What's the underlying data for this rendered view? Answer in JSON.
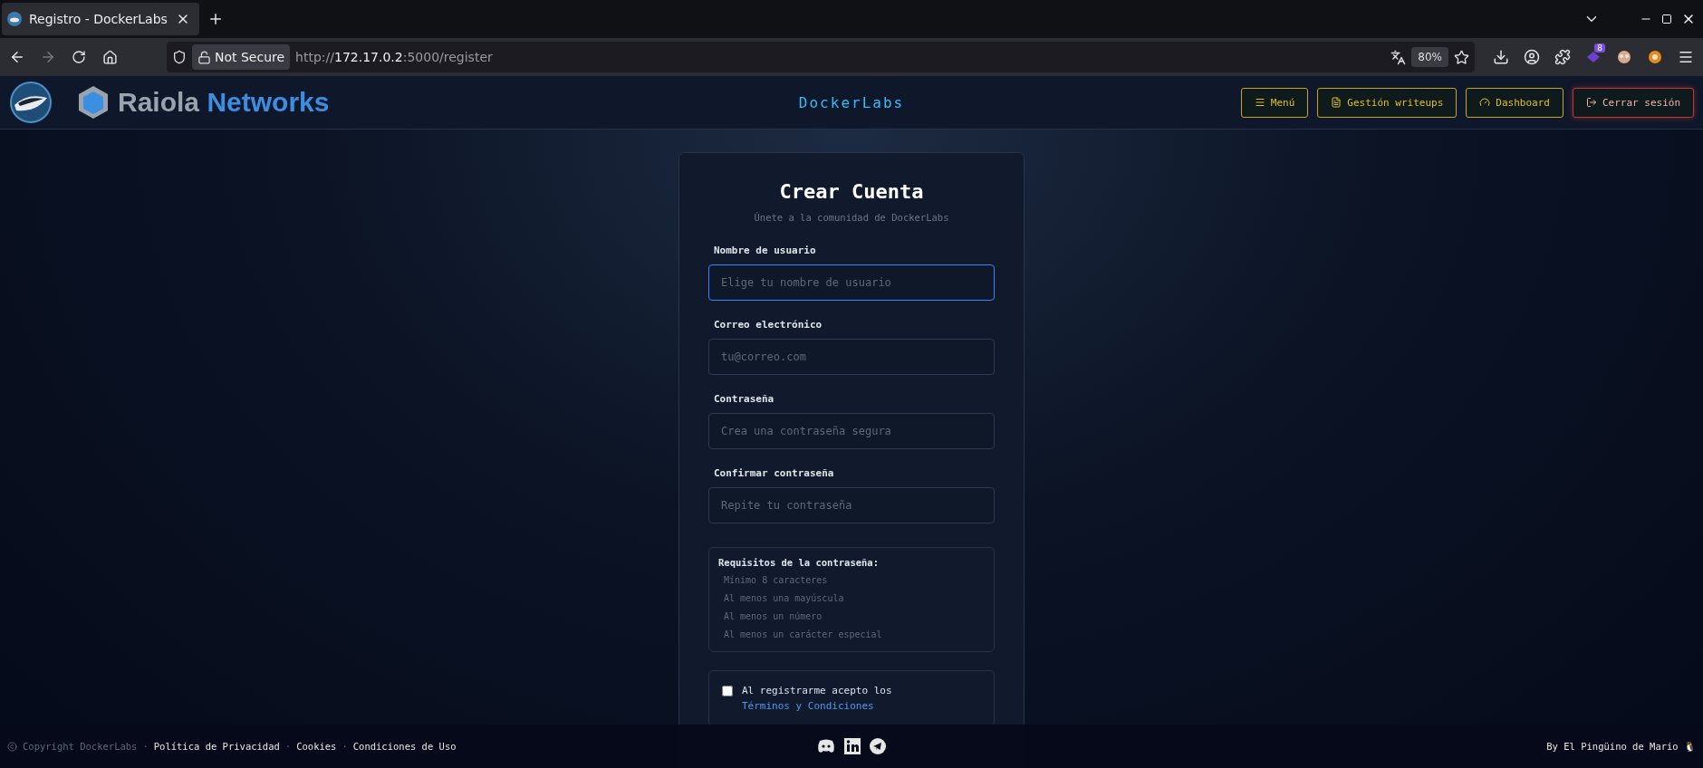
{
  "browser": {
    "tab_title": "Registro - DockerLabs",
    "url_host": "http://",
    "url_ip": "172.17.0.2",
    "url_path": ":5000/register",
    "security": "Not Secure",
    "zoom": "80%",
    "extension_badge": "8"
  },
  "header": {
    "brand": "Raiola",
    "brand_accent": "Networks",
    "site": "DockerLabs",
    "nav": [
      {
        "label": "Menú",
        "kind": "menu"
      },
      {
        "label": "Gestión writeups",
        "kind": "doc"
      },
      {
        "label": "Dashboard",
        "kind": "gauge"
      },
      {
        "label": "Cerrar sesión",
        "kind": "logout"
      }
    ]
  },
  "form": {
    "title": "Crear Cuenta",
    "subtitle": "Únete a la comunidad de DockerLabs",
    "fields": [
      {
        "label": "Nombre de usuario",
        "placeholder": "Elige tu nombre de usuario",
        "focused": true
      },
      {
        "label": "Correo electrónico",
        "placeholder": "tu@correo.com",
        "focused": false
      },
      {
        "label": "Contraseña",
        "placeholder": "Crea una contraseña segura",
        "focused": false
      },
      {
        "label": "Confirmar contraseña",
        "placeholder": "Repite tu contraseña",
        "focused": false
      }
    ],
    "requirements": {
      "title": "Requisitos de la contraseña:",
      "items": [
        "Mínimo 8 caracteres",
        "Al menos una mayúscula",
        "Al menos un número",
        "Al menos un carácter especial"
      ]
    },
    "terms": {
      "text": "Al registrarme acepto los",
      "link": "Términos y Condiciones",
      "checked": false
    }
  },
  "footer": {
    "copyright": "Copyright DockerLabs",
    "separator": "·",
    "links": [
      "Política de Privacidad",
      "Cookies",
      "Condiciones de Uso"
    ],
    "credit": "By El Pingüino de Mario 🐧"
  }
}
